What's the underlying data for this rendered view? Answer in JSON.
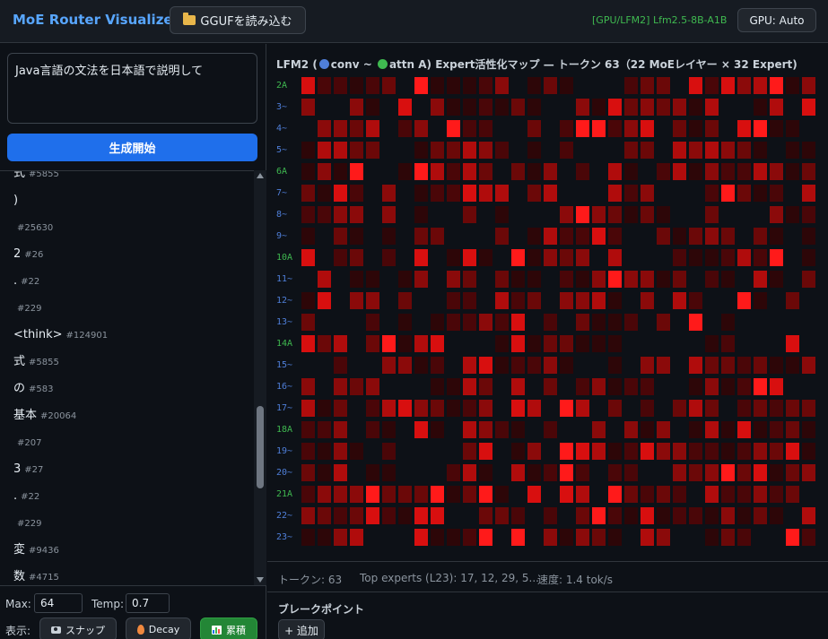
{
  "header": {
    "title": "MoE Router Visualizer",
    "load_button": "GGUFを読み込む",
    "model_status": "[GPU/LFM2] Lfm2.5-8B-A1B",
    "gpu_button": "GPU: Auto"
  },
  "prompt": {
    "value": "Java言語の文法を日本語で説明して"
  },
  "generate_button": "生成開始",
  "tokens": [
    {
      "text": "式",
      "id": "#5855"
    },
    {
      "text": ")",
      "id": ""
    },
    {
      "text": "",
      "id": "#25630"
    },
    {
      "text": "2",
      "id": "#26"
    },
    {
      "text": ".",
      "id": "#22"
    },
    {
      "text": "",
      "id": "#229"
    },
    {
      "text": "<think>",
      "id": "#124901"
    },
    {
      "text": "式",
      "id": "#5855"
    },
    {
      "text": "の",
      "id": "#583"
    },
    {
      "text": "基本",
      "id": "#20064"
    },
    {
      "text": "",
      "id": "#207"
    },
    {
      "text": "3",
      "id": "#27"
    },
    {
      "text": ".",
      "id": "#22"
    },
    {
      "text": "",
      "id": "#229"
    },
    {
      "text": "変",
      "id": "#9436"
    },
    {
      "text": "数",
      "id": "#4715"
    }
  ],
  "controls": {
    "max_label": "Max:",
    "max_value": "64",
    "temp_label": "Temp:",
    "temp_value": "0.7",
    "view_label": "表示:",
    "snap_button": "スナップ",
    "decay_button": "Decay",
    "cumulative_button": "累積"
  },
  "map": {
    "title_prefix": "LFM2 (",
    "conv_label": "conv ~",
    "attn_label": "attn A) Expert活性化マップ — トークン 63（22 MoEレイヤー × 32 Expert)",
    "conv_color": "#4f7fd9",
    "attn_color": "#3fb950",
    "rows": [
      "2A",
      "3~",
      "4~",
      "5~",
      "6A",
      "7~",
      "8~",
      "9~",
      "10A",
      "11~",
      "12~",
      "13~",
      "14A",
      "15~",
      "16~",
      "17~",
      "18A",
      "19~",
      "20~",
      "21A",
      "22~",
      "23~"
    ],
    "heat_colors": [
      "#0d1117",
      "#2d0608",
      "#4a0608",
      "#6b0808",
      "#8b0a0a",
      "#b00c0c",
      "#d80f0f",
      "#ff1a1a"
    ]
  },
  "stats": {
    "tokens": "トークン: 63",
    "top_experts": "Top experts (L23): 17, 12, 29, 5...",
    "speed": "速度: 1.4 tok/s"
  },
  "breakpoints": {
    "title": "ブレークポイント",
    "add_button": "+ 追加"
  }
}
